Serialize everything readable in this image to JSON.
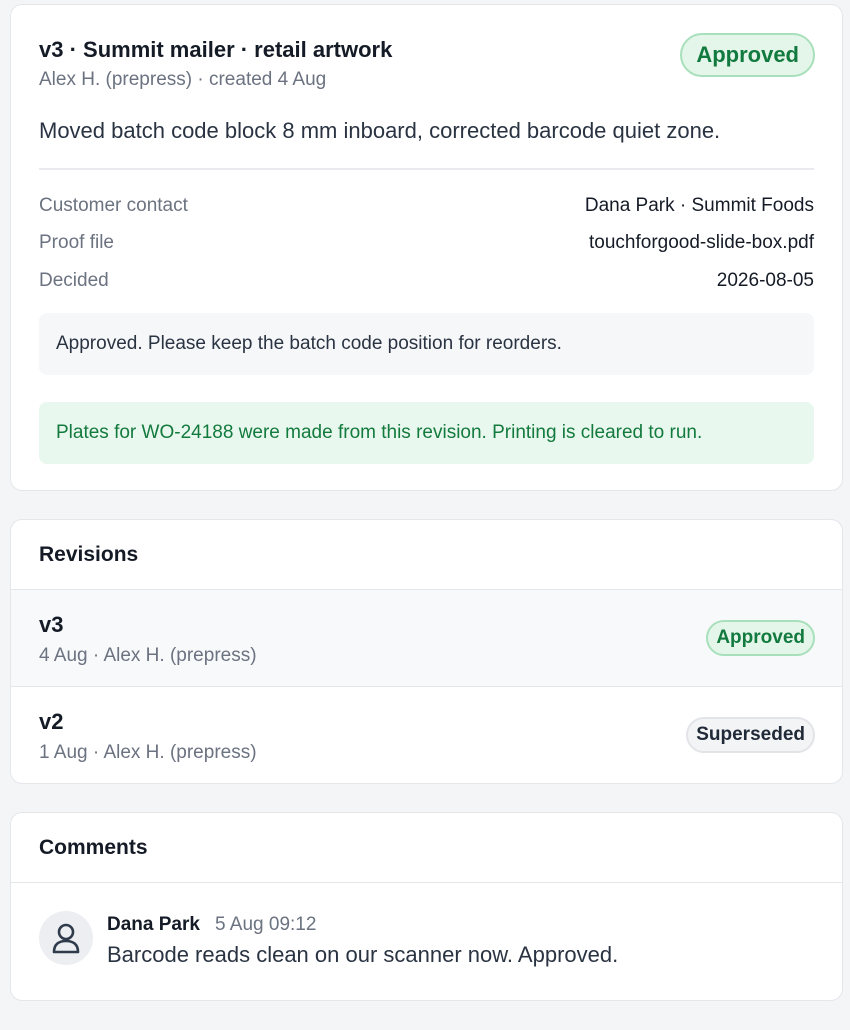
{
  "proof": {
    "title": "v3 · Summit mailer · retail artwork",
    "subtitle": "Alex H. (prepress) · created 4 Aug",
    "status": "Approved",
    "description": "Moved batch code block 8 mm inboard, corrected barcode quiet zone.",
    "details": [
      {
        "label": "Customer contact",
        "value": "Dana Park · Summit Foods"
      },
      {
        "label": "Proof file",
        "value": "touchforgood-slide-box.pdf"
      },
      {
        "label": "Decided",
        "value": "2026-08-05"
      }
    ],
    "customer_note": "Approved. Please keep the batch code position for reorders.",
    "plates_notice": "Plates for WO-24188 were made from this revision. Printing is cleared to run."
  },
  "revisions": {
    "heading": "Revisions",
    "items": [
      {
        "version": "v3",
        "meta": "4 Aug · Alex H. (prepress)",
        "status": "Approved"
      },
      {
        "version": "v2",
        "meta": "1 Aug · Alex H. (prepress)",
        "status": "Superseded"
      }
    ]
  },
  "comments": {
    "heading": "Comments",
    "items": [
      {
        "author": "Dana Park",
        "time": "5 Aug 09:12",
        "text": "Barcode reads clean on our scanner now. Approved.",
        "avatar_icon": "user-icon"
      }
    ]
  },
  "colors": {
    "approved_text": "#127a3f",
    "approved_bg": "#e4f6ea",
    "success_bg": "#e9f8ee",
    "neutral_badge_bg": "#f3f4f6"
  }
}
